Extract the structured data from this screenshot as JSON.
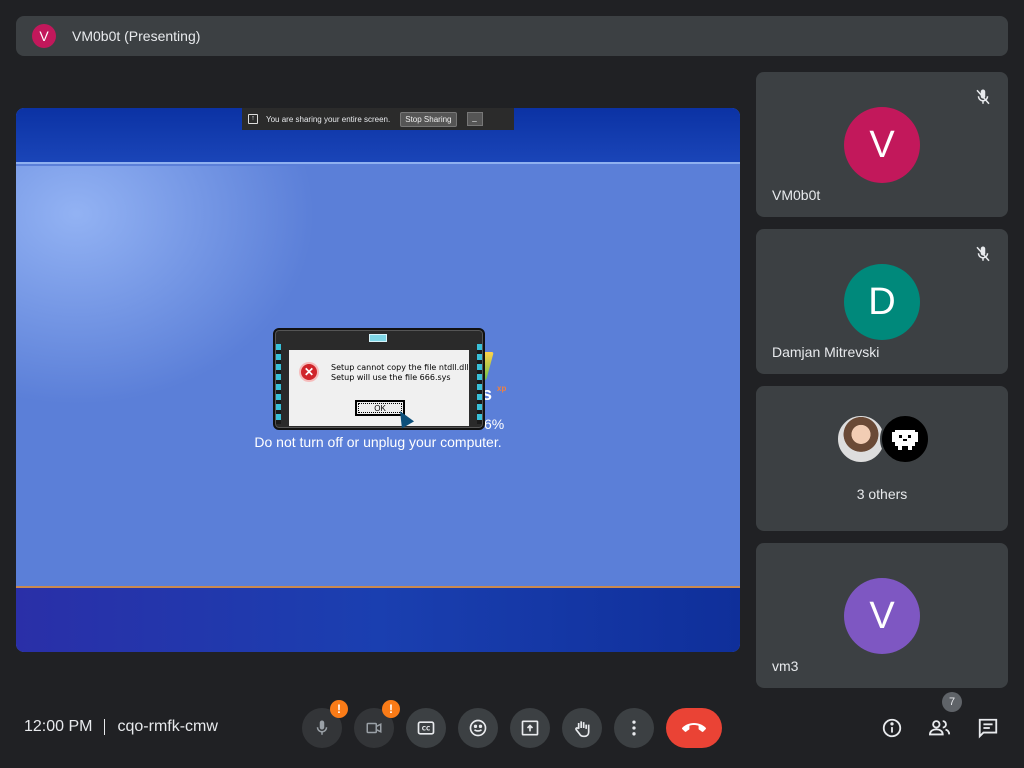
{
  "header": {
    "avatar_letter": "V",
    "avatar_color": "#c2185b",
    "presenter_title": "VM0b0t (Presenting)"
  },
  "screen_share": {
    "banner": {
      "sharing_text": "You are sharing your entire screen.",
      "stop_label": "Stop Sharing",
      "minimize_label": "_"
    },
    "setup_status": "Do not turn off or unplug your computer.",
    "fragment_s": "s",
    "fragment_xp": "xp",
    "fragment_pct": "6%",
    "error_dialog": {
      "icon_glyph": "✕",
      "line1": "Setup cannot copy the file ntdll.dll",
      "line2": "Setup will use the file 666.sys",
      "ok_label": "OK"
    }
  },
  "participants": [
    {
      "name": "VM0b0t",
      "letter": "V",
      "color": "#c2185b",
      "muted": true
    },
    {
      "name": "Damjan Mitrevski",
      "letter": "D",
      "color": "#00897b",
      "muted": true
    },
    {
      "others_label": "3 others"
    },
    {
      "name": "vm3",
      "letter": "V",
      "color": "#7e57c2",
      "muted": false
    }
  ],
  "bottom_bar": {
    "time": "12:00 PM",
    "meeting_code": "cqo-rmfk-cmw",
    "mic_warning": "!",
    "camera_warning": "!",
    "people_count": "7",
    "controls": [
      "mic-icon",
      "camera-icon",
      "captions-icon",
      "emoji-icon",
      "present-icon",
      "raise-hand-icon",
      "more-options-icon",
      "end-call-icon"
    ],
    "end_call_color": "#ea4335"
  }
}
